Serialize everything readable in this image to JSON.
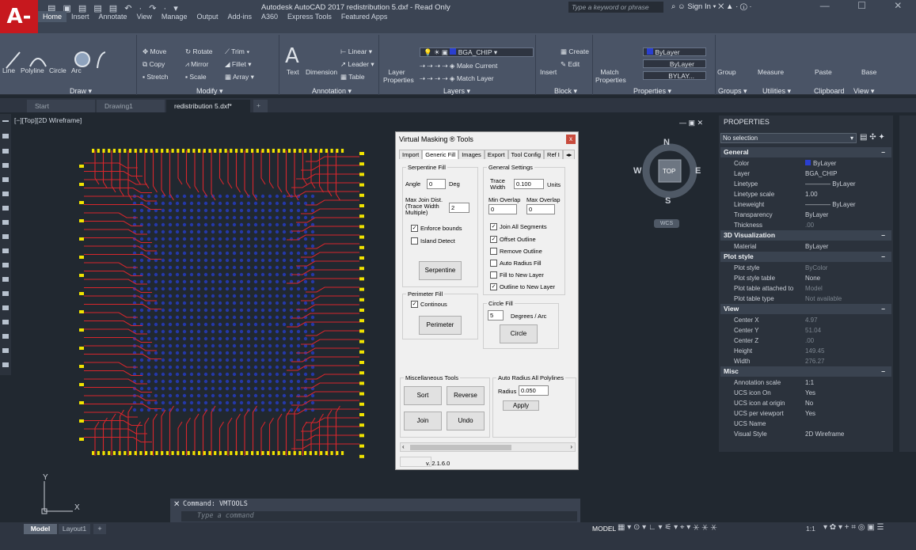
{
  "app": {
    "logo": "A-",
    "title": "Autodesk AutoCAD 2017   redistribution 5.dxf - Read Only",
    "search_placeholder": "Type a keyword or phrase",
    "sign_in": "Sign In"
  },
  "menu_tabs": [
    "Home",
    "Insert",
    "Annotate",
    "View",
    "Manage",
    "Output",
    "Add-ins",
    "A360",
    "Express Tools",
    "Featured Apps"
  ],
  "ribbon": {
    "draw": {
      "label": "Draw ▾",
      "line": "Line",
      "polyline": "Polyline",
      "circle": "Circle",
      "arc": "Arc"
    },
    "modify": {
      "label": "Modify ▾",
      "move": "Move",
      "rotate": "Rotate",
      "trim": "Trim ▾",
      "copy": "Copy",
      "mirror": "Mirror",
      "fillet": "Fillet ▾",
      "stretch": "Stretch",
      "scale": "Scale",
      "array": "Array ▾"
    },
    "annotation": {
      "label": "Annotation ▾",
      "text": "Text",
      "dimension": "Dimension",
      "linear": "Linear ▾",
      "leader": "Leader ▾",
      "table": "Table"
    },
    "layers": {
      "label": "Layers ▾",
      "layer_properties": "Layer Properties",
      "current_layer": "BGA_CHIP",
      "make_current": "Make Current",
      "match_layer": "Match Layer"
    },
    "block": {
      "label": "Block ▾",
      "insert": "Insert",
      "create": "Create",
      "edit": "Edit"
    },
    "properties": {
      "label": "Properties ▾",
      "match_properties": "Match Properties",
      "bylayer1": "ByLayer",
      "bylayer2": "ByLayer",
      "bylayer3": "BYLAY..."
    },
    "groups": {
      "label": "Groups ▾",
      "group": "Group"
    },
    "utilities": {
      "label": "Utilities ▾",
      "measure": "Measure"
    },
    "clipboard": {
      "label": "Clipboard",
      "paste": "Paste"
    },
    "view": {
      "label": "View ▾",
      "base": "Base"
    }
  },
  "doc_tabs": [
    "Start",
    "Drawing1",
    "redistribution 5.dxf*"
  ],
  "viewport_label": "[−][Top][2D Wireframe]",
  "viewcube": {
    "n": "N",
    "s": "S",
    "e": "E",
    "w": "W",
    "top": "TOP",
    "wcs": "WCS"
  },
  "dialog": {
    "title": "Virtual Masking ® Tools",
    "close": "x",
    "tabs": [
      "Import",
      "Generic Fill",
      "Images",
      "Export",
      "Tool Config",
      "Ref I"
    ],
    "serpentine": {
      "group": "Serpentine Fill",
      "angle_label": "Angle",
      "angle": "0",
      "angle_unit": "Deg",
      "max_join_label1": "Max Join Dist.",
      "max_join_label2": "(Trace Width",
      "max_join_label3": "Multiple)",
      "max_join": "2",
      "enforce_bounds": "Enforce bounds",
      "island_detect": "Island Detect",
      "button": "Serpentine"
    },
    "general": {
      "group": "General Settings",
      "trace_label1": "Trace",
      "trace_label2": "Width",
      "trace_width": "0.100",
      "units": "Units",
      "min_overlap": "Min Overlap",
      "max_overlap": "Max Overlap",
      "min_val": "0",
      "max_val": "0",
      "join_all": "Join All Segments",
      "offset_outline": "Offset Outline",
      "remove_outline": "Remove Outline",
      "auto_radius": "Auto Radius Fill",
      "fill_new_layer": "Fill to New Layer",
      "outline_new_layer": "Outline to New Layer"
    },
    "perimeter": {
      "group": "Perimeter Fill",
      "continuous": "Continous",
      "button": "Perimeter"
    },
    "circle": {
      "group": "Circle Fill",
      "value": "5",
      "label": "Degrees / Arc",
      "button": "Circle"
    },
    "misc": {
      "group": "Miscellaneous Tools",
      "sort": "Sort",
      "reverse": "Reverse",
      "join": "Join",
      "undo": "Undo"
    },
    "auto_radius_all": {
      "group": "Auto Radius All Polylines",
      "radius_label": "Radius",
      "radius": "0.050",
      "apply": "Apply"
    },
    "version": "v. 2.1.6.0"
  },
  "properties_panel": {
    "title": "PROPERTIES",
    "selection": "No selection",
    "general": {
      "title": "General",
      "rows": [
        [
          "Color",
          "ByLayer"
        ],
        [
          "Layer",
          "BGA_CHIP"
        ],
        [
          "Linetype",
          "———— ByLayer"
        ],
        [
          "Linetype scale",
          "1.00"
        ],
        [
          "Lineweight",
          "———— ByLayer"
        ],
        [
          "Transparency",
          "ByLayer"
        ],
        [
          "Thickness",
          ".00"
        ]
      ]
    },
    "viz3d": {
      "title": "3D Visualization",
      "rows": [
        [
          "Material",
          "ByLayer"
        ]
      ]
    },
    "plot": {
      "title": "Plot style",
      "rows": [
        [
          "Plot style",
          "ByColor"
        ],
        [
          "Plot style table",
          "None"
        ],
        [
          "Plot table attached to",
          "Model"
        ],
        [
          "Plot table type",
          "Not available"
        ]
      ]
    },
    "view": {
      "title": "View",
      "rows": [
        [
          "Center X",
          "4.97"
        ],
        [
          "Center Y",
          "51.04"
        ],
        [
          "Center Z",
          ".00"
        ],
        [
          "Height",
          "149.45"
        ],
        [
          "Width",
          "276.27"
        ]
      ]
    },
    "misc": {
      "title": "Misc",
      "rows": [
        [
          "Annotation scale",
          "1:1"
        ],
        [
          "UCS icon On",
          "Yes"
        ],
        [
          "UCS icon at origin",
          "No"
        ],
        [
          "UCS per viewport",
          "Yes"
        ],
        [
          "UCS Name",
          ""
        ],
        [
          "Visual Style",
          "2D Wireframe"
        ]
      ]
    }
  },
  "command": {
    "history": "Command: VMTOOLS",
    "placeholder": "Type a command"
  },
  "layout_tabs": [
    "Model",
    "Layout1",
    "+"
  ],
  "status": {
    "model": "MODEL",
    "scale": "1:1"
  },
  "colors": {
    "trace": "#d8262c",
    "pad": "#f0e300",
    "via": "#2438a8"
  }
}
